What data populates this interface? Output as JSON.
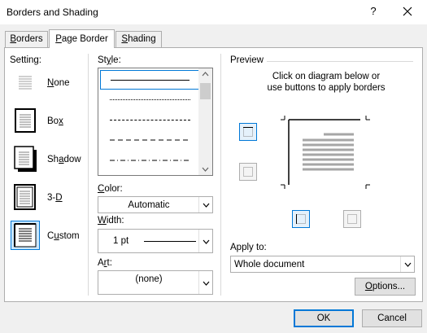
{
  "window": {
    "title": "Borders and Shading",
    "help": "?"
  },
  "tabs": [
    {
      "label": "Borders",
      "mnemonic": "B",
      "rest": "orders"
    },
    {
      "label": "Page Border",
      "mnemonic": "P",
      "rest": "age Border"
    },
    {
      "label": "Shading",
      "mnemonic": "S",
      "rest": "hading"
    }
  ],
  "settings": {
    "heading": "Setting:",
    "items": [
      {
        "label": "None",
        "mnemonic": "N",
        "rest": "one"
      },
      {
        "label": "Box",
        "mnemonic": "x",
        "pre": "Bo"
      },
      {
        "label": "Shadow",
        "mnemonic": "a",
        "pre": "Sh",
        "rest": "dow"
      },
      {
        "label": "3-D",
        "mnemonic": "D",
        "pre": "3-"
      },
      {
        "label": "Custom",
        "mnemonic": "u",
        "pre": "C",
        "rest": "stom"
      }
    ],
    "selected": "Custom"
  },
  "style": {
    "heading": "Style:",
    "mnemonic": "y",
    "pre": "St",
    "rest": "le:"
  },
  "color": {
    "heading": "Color:",
    "mnemonic": "C",
    "rest": "olor:",
    "value": "Automatic"
  },
  "width": {
    "heading": "Width:",
    "mnemonic": "W",
    "rest": "idth:",
    "value": "1 pt"
  },
  "art": {
    "heading": "Art:",
    "mnemonic": "r",
    "pre": "A",
    "rest": "t:",
    "value": "(none)"
  },
  "preview": {
    "heading": "Preview",
    "instruction_line1": "Click on diagram below or",
    "instruction_line2": "use buttons to apply borders"
  },
  "apply_to": {
    "heading": "Apply to:",
    "mnemonic": "L",
    "value": "Whole document"
  },
  "buttons": {
    "options": {
      "label": "Options...",
      "mnemonic": "O",
      "rest": "ptions..."
    },
    "ok": "OK",
    "cancel": "Cancel"
  },
  "colors": {
    "accent": "#0078d7",
    "selected_bg": "#cce8ff"
  }
}
